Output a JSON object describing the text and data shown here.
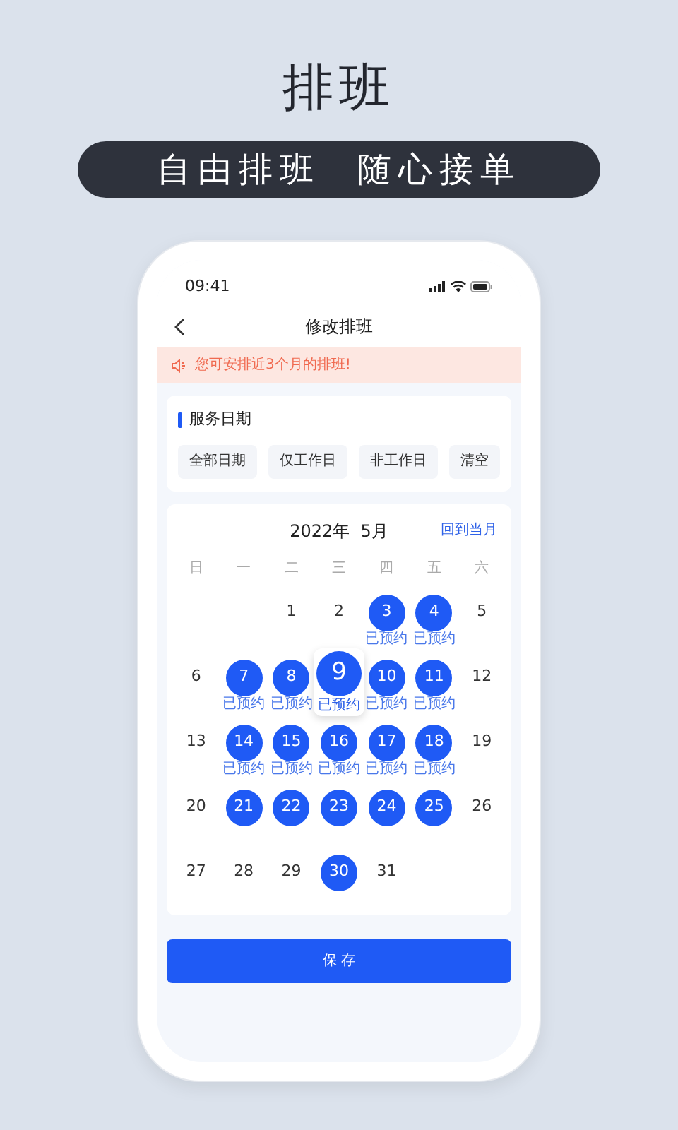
{
  "headline": "排班",
  "slogan": [
    "自由排班",
    "随心接单"
  ],
  "status_bar": {
    "time": "09:41"
  },
  "nav": {
    "title": "修改排班"
  },
  "notice": "您可安排近3个月的排班!",
  "service_dates": {
    "title": "服务日期",
    "options": [
      "全部日期",
      "仅工作日",
      "非工作日",
      "清空"
    ]
  },
  "calendar": {
    "month": "2022年  5月",
    "back_link": "回到当月",
    "weekdays": [
      "日",
      "一",
      "二",
      "三",
      "四",
      "五",
      "六"
    ],
    "weeks": [
      [
        {
          "kind": "blank"
        },
        {
          "kind": "blank"
        },
        {
          "kind": "day",
          "day": "1",
          "selected": false
        },
        {
          "kind": "day",
          "day": "2",
          "selected": false
        },
        {
          "kind": "day",
          "day": "3",
          "selected": true,
          "note": "已预约"
        },
        {
          "kind": "day",
          "day": "4",
          "selected": true,
          "note": "已预约"
        },
        {
          "kind": "day",
          "day": "5",
          "selected": false
        }
      ],
      [
        {
          "kind": "day",
          "day": "6",
          "selected": false
        },
        {
          "kind": "day",
          "day": "7",
          "selected": true,
          "note": "已预约"
        },
        {
          "kind": "day",
          "day": "8",
          "selected": true,
          "note": "已预约"
        },
        {
          "kind": "magnified",
          "day": "9",
          "selected": true,
          "note": "已预约"
        },
        {
          "kind": "day",
          "day": "10",
          "selected": true,
          "note": "已预约"
        },
        {
          "kind": "day",
          "day": "11",
          "selected": true,
          "note": "已预约"
        },
        {
          "kind": "day",
          "day": "12",
          "selected": false
        }
      ],
      [
        {
          "kind": "day",
          "day": "13",
          "selected": false
        },
        {
          "kind": "day",
          "day": "14",
          "selected": true,
          "note": "已预约"
        },
        {
          "kind": "day",
          "day": "15",
          "selected": true,
          "note": "已预约"
        },
        {
          "kind": "day",
          "day": "16",
          "selected": true,
          "note": "已预约"
        },
        {
          "kind": "day",
          "day": "17",
          "selected": true,
          "note": "已预约"
        },
        {
          "kind": "day",
          "day": "18",
          "selected": true,
          "note": "已预约"
        },
        {
          "kind": "day",
          "day": "19",
          "selected": false
        }
      ],
      [
        {
          "kind": "day",
          "day": "20",
          "selected": false
        },
        {
          "kind": "day",
          "day": "21",
          "selected": true
        },
        {
          "kind": "day",
          "day": "22",
          "selected": true
        },
        {
          "kind": "day",
          "day": "23",
          "selected": true
        },
        {
          "kind": "day",
          "day": "24",
          "selected": true
        },
        {
          "kind": "day",
          "day": "25",
          "selected": true
        },
        {
          "kind": "day",
          "day": "26",
          "selected": false
        }
      ],
      [
        {
          "kind": "day",
          "day": "27",
          "selected": false
        },
        {
          "kind": "day",
          "day": "28",
          "selected": false
        },
        {
          "kind": "day",
          "day": "29",
          "selected": false
        },
        {
          "kind": "day",
          "day": "30",
          "selected": true
        },
        {
          "kind": "day",
          "day": "31",
          "selected": false
        },
        {
          "kind": "blank"
        },
        {
          "kind": "blank"
        }
      ]
    ]
  },
  "save_button": "保 存"
}
